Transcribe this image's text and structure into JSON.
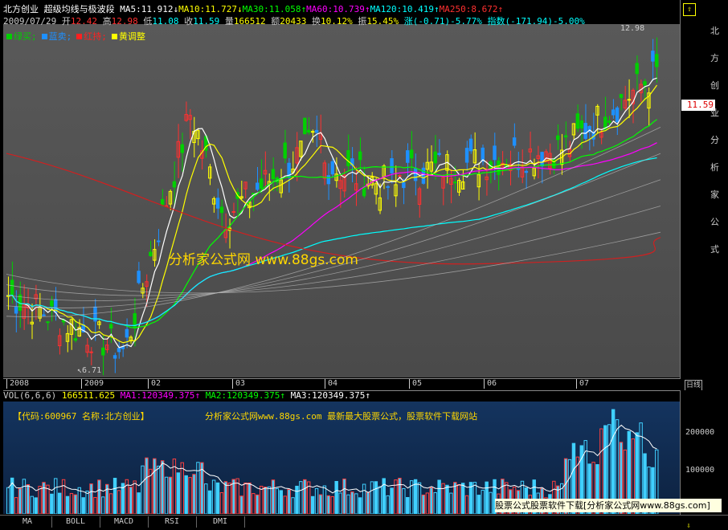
{
  "header": {
    "stock_name": "北方创业",
    "formula_name": "超级均线与极波段",
    "ma_items": [
      {
        "label": "MA5:11.912",
        "arrow": "↓",
        "color": "#ffffff"
      },
      {
        "label": "MA10:11.727",
        "arrow": "↓",
        "color": "#ffff00"
      },
      {
        "label": "MA30:11.058",
        "arrow": "↑",
        "color": "#00ff00"
      },
      {
        "label": "MA60:10.739",
        "arrow": "↑",
        "color": "#ff00ff"
      },
      {
        "label": "MA120:10.419",
        "arrow": "↑",
        "color": "#00ffff"
      },
      {
        "label": "MA250:8.672",
        "arrow": "↑",
        "color": "#ff3030"
      }
    ],
    "date": "2009/07/29",
    "open_label": "开",
    "open": "12.42",
    "high_label": "高",
    "high": "12.98",
    "low_label": "低",
    "low": "11.08",
    "close_label": "收",
    "close": "11.59",
    "vol_label": "量",
    "vol": "166512",
    "amount_label": "额",
    "amount": "20433",
    "turnover_label": "换",
    "turnover": "10.12%",
    "amplitude_label": "振",
    "amplitude": "15.45%",
    "change_label": "涨",
    "change": "(-0.71)-5.77%",
    "index_label": "指数",
    "index": "(-171.94)-5.00%"
  },
  "legend": [
    {
      "label": "绿买;",
      "color": "#00d000"
    },
    {
      "label": "蓝卖;",
      "color": "#1e90ff"
    },
    {
      "label": "红持;",
      "color": "#ff2020"
    },
    {
      "label": "黄调整",
      "color": "#ffff00"
    }
  ],
  "main": {
    "max_price": "12.98",
    "min_price": "6.71",
    "current_price": "11.59",
    "watermark": "分析家公式网 www.88gs.com"
  },
  "date_ticks": [
    "2008",
    "2009",
    "02",
    "03",
    "04",
    "05",
    "06",
    "07"
  ],
  "right_button": "日线",
  "volume": {
    "header_name": "VOL(6,6,6)",
    "value": "166511.625",
    "ma1": "MA1:120349.375",
    "ma2": "MA2:120349.375",
    "ma3": "MA3:120349.375",
    "info": "【代码:600967 名称:北方创业】",
    "site": "分析家公式网www.88gs.com 最新最大股票公式，股票软件下载网站",
    "scale": [
      "200000",
      "100000"
    ],
    "banner": "股票公式股票软件下载[分析家公式网www.88gs.com]"
  },
  "tabs": [
    "MA",
    "BOLL",
    "MACD",
    "RSI",
    "DMI"
  ],
  "side_chars": [
    "北",
    "方",
    "创",
    "业",
    "分",
    "析",
    "家",
    "公",
    "式"
  ],
  "chart_data": {
    "type": "candlestick",
    "title": "北方创业 超级均线与极波段",
    "price_range": [
      6.71,
      12.98
    ],
    "series": [
      {
        "name": "MA5",
        "value": 11.912,
        "color": "#ffffff"
      },
      {
        "name": "MA10",
        "value": 11.727,
        "color": "#ffff00"
      },
      {
        "name": "MA30",
        "value": 11.058,
        "color": "#00ff00"
      },
      {
        "name": "MA60",
        "value": 10.739,
        "color": "#ff00ff"
      },
      {
        "name": "MA120",
        "value": 10.419,
        "color": "#00ffff"
      },
      {
        "name": "MA250",
        "value": 8.672,
        "color": "#ff3030"
      }
    ],
    "volume_scale": [
      100000,
      200000
    ]
  }
}
